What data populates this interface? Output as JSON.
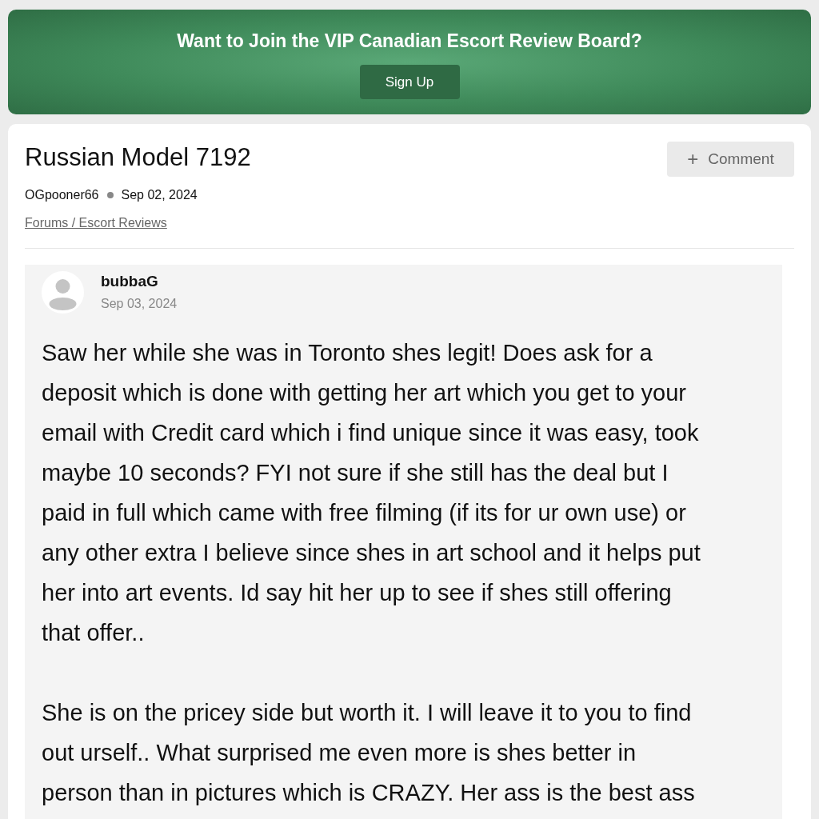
{
  "banner": {
    "title": "Want to Join the VIP Canadian Escort Review Board?",
    "button": "Sign Up"
  },
  "thread": {
    "title": "Russian Model 7192",
    "comment_button": {
      "icon": "+",
      "label": "Comment"
    },
    "author": "OGpooner66",
    "date": "Sep 02, 2024",
    "breadcrumb": "Forums / Escort Reviews"
  },
  "post": {
    "author": "bubbaG",
    "date": "Sep 03, 2024",
    "paragraphs": [
      [
        "Saw her while she was in Toronto shes legit! Does ask for a",
        "deposit which is done with getting her art which you get to your",
        "email with Credit card which i find unique since it was easy, took",
        "maybe 10 seconds? FYI not sure if she still has the deal but I",
        "paid in full which came with free filming (if its for ur own use) or",
        "any other extra I believe since shes in art school and it helps put",
        "her into art events. Id say hit her up to see if shes still offering",
        "that offer.."
      ],
      [
        "She is on the pricey side but worth it. I will leave it to you to find",
        "out urself.. What surprised me even more is shes better in",
        "person than in pictures which is CRAZY. Her ass is the best ass"
      ]
    ]
  }
}
